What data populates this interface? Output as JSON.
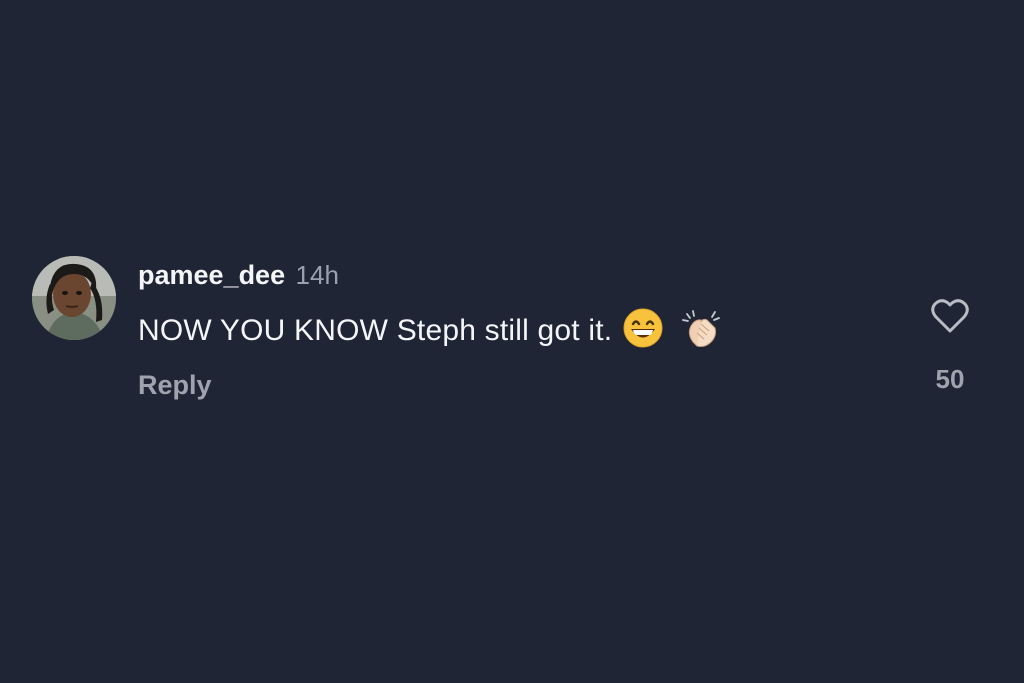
{
  "comment": {
    "username": "pamee_dee",
    "timestamp": "14h",
    "text": "NOW YOU KNOW Steph still got it.",
    "emojis": [
      "grinning-face-with-smiling-eyes",
      "clapping-hands"
    ],
    "reply_label": "Reply",
    "like_count": "50"
  },
  "colors": {
    "background": "#1f2535",
    "text_primary": "#f4f5f7",
    "text_secondary": "#9ea3ae"
  }
}
